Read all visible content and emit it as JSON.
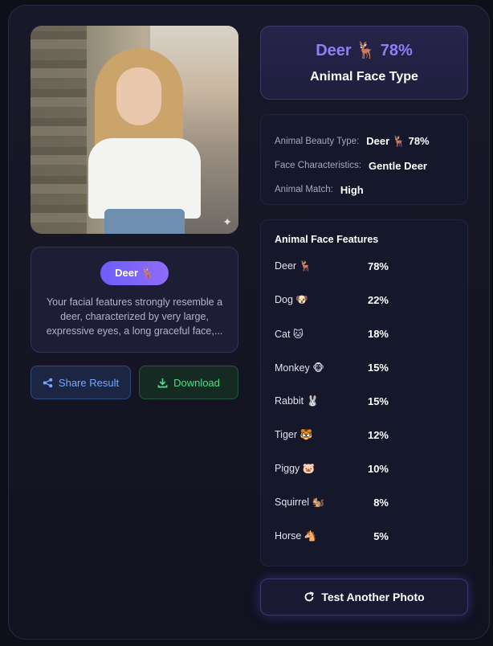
{
  "result_card": {
    "headline": "Deer 🦌 78%",
    "title": "Animal Face Type"
  },
  "photo": {
    "icon": "sparkle-icon"
  },
  "description": {
    "badge": "Deer 🦌",
    "text": "Your facial features strongly resemble a deer, characterized by very large, expressive eyes, a long graceful face,..."
  },
  "actions": {
    "share_label": "Share Result",
    "download_label": "Download",
    "test_label": "Test Another Photo"
  },
  "info": {
    "rows": [
      {
        "label": "Animal Beauty Type:",
        "value": "Deer 🦌 78%"
      },
      {
        "label": "Face Characteristics:",
        "value": "Gentle Deer"
      },
      {
        "label": "Animal Match:",
        "value": "High"
      }
    ]
  },
  "features": {
    "title": "Animal Face Features",
    "items": [
      {
        "name": "Deer 🦌",
        "pct": "78%"
      },
      {
        "name": "Dog 🐶",
        "pct": "22%"
      },
      {
        "name": "Cat 🐱",
        "pct": "18%"
      },
      {
        "name": "Monkey 🐵",
        "pct": "15%"
      },
      {
        "name": "Rabbit 🐰",
        "pct": "15%"
      },
      {
        "name": "Tiger 🐯",
        "pct": "12%"
      },
      {
        "name": "Piggy 🐷",
        "pct": "10%"
      },
      {
        "name": "Squirrel 🐿️",
        "pct": "8%"
      },
      {
        "name": "Horse 🐴",
        "pct": "5%"
      }
    ]
  },
  "colors": {
    "accent": "#8e7ff5",
    "share": "#79a6ff",
    "download": "#4fdc8a"
  }
}
